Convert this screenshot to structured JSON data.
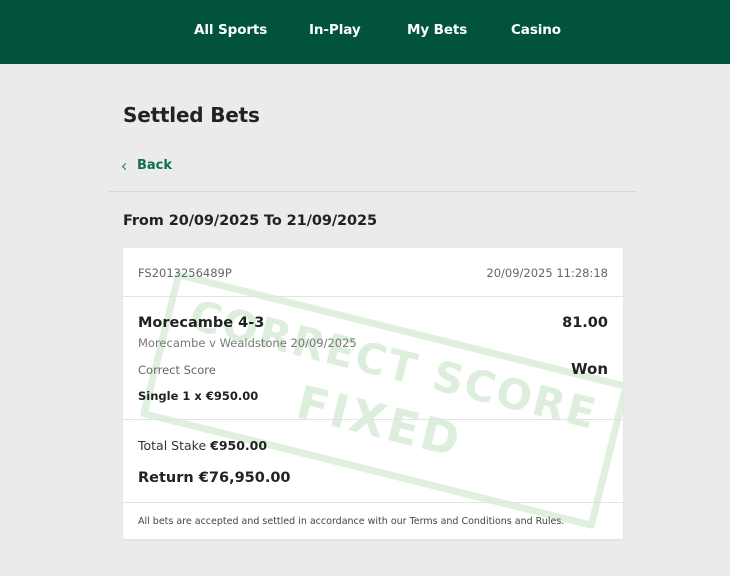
{
  "nav": {
    "items": [
      {
        "label": "All Sports"
      },
      {
        "label": "In-Play"
      },
      {
        "label": "My Bets"
      },
      {
        "label": "Casino"
      }
    ]
  },
  "page": {
    "title": "Settled Bets",
    "back_label": "Back",
    "date_range": "From 20/09/2025 To 21/09/2025"
  },
  "bet": {
    "reference": "FS2013256489P",
    "timestamp": "20/09/2025 11:28:18",
    "selection": "Morecambe 4-3",
    "odds": "81.00",
    "event": "Morecambe v Wealdstone 20/09/2025",
    "market": "Correct Score",
    "result": "Won",
    "bet_line": "Single 1 x €950.00",
    "total_stake_label": "Total Stake",
    "total_stake_value": "€950.00",
    "return_label": "Return",
    "return_value": "€76,950.00",
    "terms": "All bets are accepted and settled in accordance with our Terms and Conditions and Rules."
  },
  "stamp": {
    "line1": "CORRECT SCORE",
    "line2": "FIXED",
    "color": "#96cd91"
  },
  "colors": {
    "header_bg": "#02533b",
    "link": "#0e7050",
    "page_bg": "#ebebeb"
  }
}
